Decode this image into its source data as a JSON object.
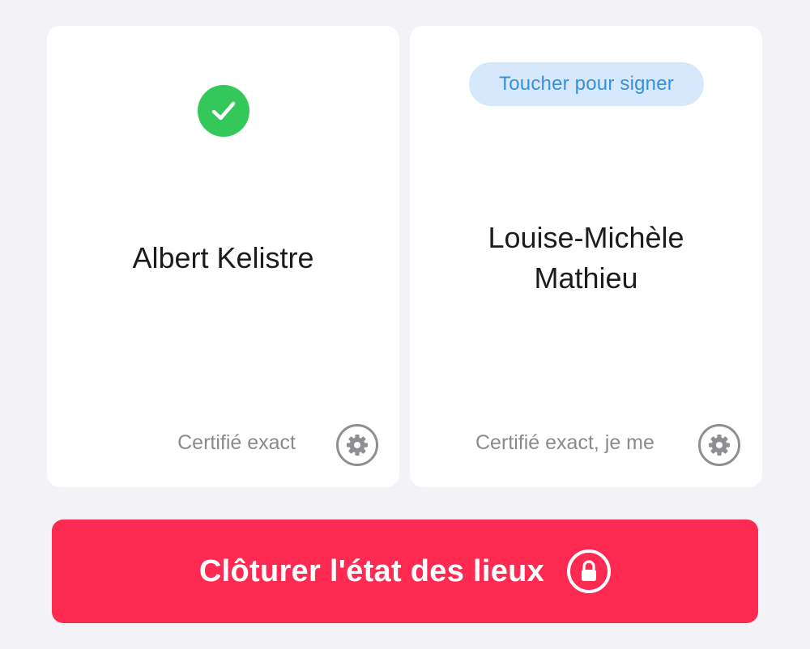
{
  "colors": {
    "background": "#f2f2f7",
    "card": "#ffffff",
    "success": "#34c759",
    "pill_bg": "#d6e9fc",
    "pill_text": "#3a8fd9",
    "primary_button": "#fe2a51",
    "secondary_text": "#8a8a8e"
  },
  "signers": [
    {
      "name": "Albert Kelistre",
      "status": "signed",
      "status_icon": "checkmark-circle-icon",
      "certification_text": "Certifié exact",
      "settings_icon": "gear-icon"
    },
    {
      "name_line1": "Louise-Michèle",
      "name_line2": "Mathieu",
      "status": "pending",
      "action_label": "Toucher pour signer",
      "certification_text": "Certifié exact, je me",
      "settings_icon": "gear-icon"
    }
  ],
  "close_button": {
    "label": "Clôturer l'état des lieux",
    "icon": "lock-icon"
  }
}
